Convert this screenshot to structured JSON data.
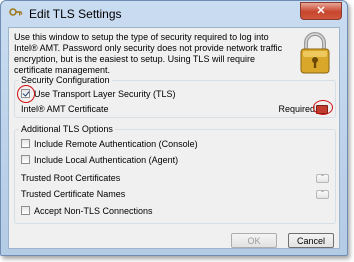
{
  "window": {
    "title": "Edit TLS Settings",
    "close_glyph": "✕",
    "app_icon": "key-icon"
  },
  "intro_text": "Use this window to setup the type of security required to log into Intel® AMT. Password only security does not provide network traffic encryption, but is the easiest to setup. Using TLS will require certificate management.",
  "security_configuration": {
    "legend": "Security Configuration",
    "use_tls": {
      "label": "Use Transport Layer Security (TLS)",
      "checked": true
    },
    "certificate": {
      "label": "Intel® AMT Certificate",
      "status": "Required",
      "icon": "certificate-icon"
    }
  },
  "additional_tls_options": {
    "legend": "Additional TLS Options",
    "remote_auth": {
      "label": "Include Remote Authentication (Console)",
      "checked": false
    },
    "local_auth": {
      "label": "Include Local Authentication (Agent)",
      "checked": false
    },
    "trusted_root": {
      "label": "Trusted Root Certificates",
      "expander": "⌃"
    },
    "trusted_names": {
      "label": "Trusted Certificate Names",
      "expander": "⌃"
    },
    "non_tls": {
      "label": "Accept Non-TLS Connections",
      "checked": false
    }
  },
  "buttons": {
    "ok": {
      "label": "OK",
      "enabled": false
    },
    "cancel": {
      "label": "Cancel",
      "enabled": true
    }
  },
  "colors": {
    "highlight": "#d01010",
    "titlebar": "#c9dcf1"
  }
}
